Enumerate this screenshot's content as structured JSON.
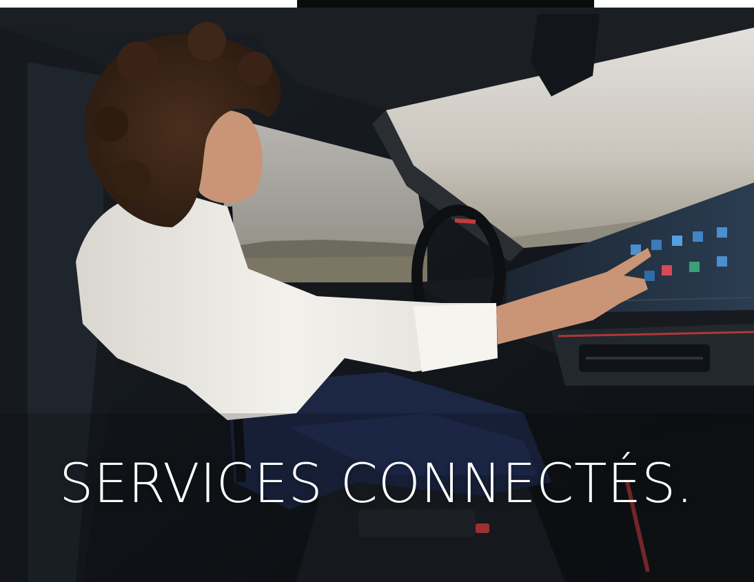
{
  "headline": "SERVICES CONNECTÉS.",
  "colors": {
    "text": "#ffffff",
    "sky_top": "#dcd6cf",
    "sky_bottom": "#a9a59a",
    "cabin_dark": "#14181d",
    "blouse": "#efede8",
    "trousers": "#1c2743",
    "hair": "#3a2316",
    "skin": "#c99576",
    "screen_dark": "#0c1016",
    "accent_red": "#d43b3b"
  },
  "icons": [
    "car-interior-photo",
    "display-screen",
    "steering-wheel",
    "air-vent"
  ]
}
